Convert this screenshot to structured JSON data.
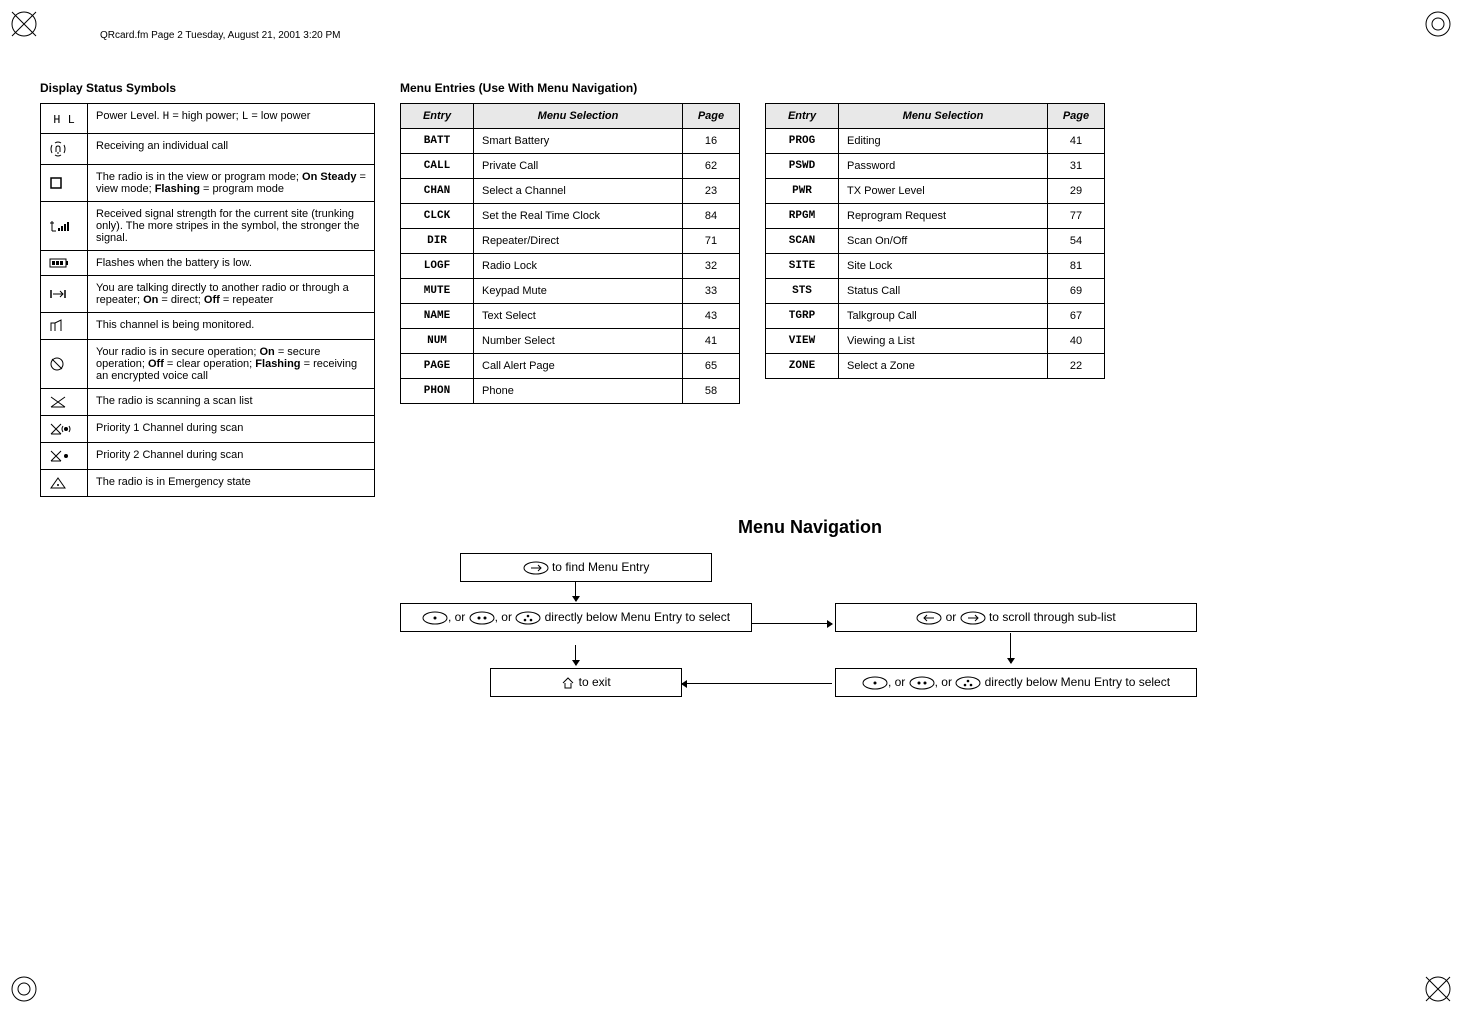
{
  "header_small": "QRcard.fm  Page 2  Tuesday, August 21, 2001  3:20 PM",
  "col1_title": "Display Status Symbols",
  "status_rows": [
    {
      "sym": "H L",
      "desc_html": "Power Level. <span style='font-family:Courier New'>H</span> = high power; <span style='font-family:Courier New'>L</span> = low power"
    },
    {
      "sym": "ring",
      "desc_html": "Receiving an individual call"
    },
    {
      "sym": "square",
      "desc_html": "The radio is in the view or program mode; <b>On Steady</b> = view mode; <b>Flashing</b> = program mode"
    },
    {
      "sym": "signal",
      "desc_html": "Received signal strength for the current site (trunking only). The more stripes in the symbol, the stronger the signal."
    },
    {
      "sym": "battery",
      "desc_html": "Flashes when the battery is low."
    },
    {
      "sym": "direct",
      "desc_html": "You are talking directly to another radio or through a repeater; <b>On</b> = direct; <b>Off</b> = repeater"
    },
    {
      "sym": "monitor",
      "desc_html": "This channel is being monitored."
    },
    {
      "sym": "secure",
      "desc_html": "Your radio is in secure operation; <b>On</b> = secure operation; <b>Off</b> = clear operation; <b>Flashing</b> = receiving an encrypted voice call"
    },
    {
      "sym": "scan",
      "desc_html": "The radio is scanning a scan list"
    },
    {
      "sym": "scan-p1",
      "desc_html": "Priority 1 Channel during scan"
    },
    {
      "sym": "scan-p2",
      "desc_html": "Priority 2 Channel during scan"
    },
    {
      "sym": "emergency",
      "desc_html": "The radio is in Emergency state"
    }
  ],
  "col2_title": "Menu Entries (Use With Menu Navigation)",
  "menu_header": {
    "entry": "Entry",
    "sel": "Menu Selection",
    "page": "Page"
  },
  "menu_rows_a": [
    {
      "entry": "BATT",
      "sel": "Smart Battery",
      "page": "16"
    },
    {
      "entry": "CALL",
      "sel": "Private Call",
      "page": "62"
    },
    {
      "entry": "CHAN",
      "sel": "Select a Channel",
      "page": "23"
    },
    {
      "entry": "CLCK",
      "sel": "Set the Real Time Clock",
      "page": "84"
    },
    {
      "entry": "DIR",
      "sel": "Repeater/Direct",
      "page": "71"
    },
    {
      "entry": "LOGF",
      "sel": "Radio Lock",
      "page": "32"
    },
    {
      "entry": "MUTE",
      "sel": "Keypad Mute",
      "page": "33"
    },
    {
      "entry": "NAME",
      "sel": "Text Select",
      "page": "43"
    },
    {
      "entry": "NUM",
      "sel": "Number Select",
      "page": "41"
    },
    {
      "entry": "PAGE",
      "sel": "Call Alert Page",
      "page": "65"
    },
    {
      "entry": "PHON",
      "sel": "Phone",
      "page": "58"
    }
  ],
  "menu_rows_b": [
    {
      "entry": "PROG",
      "sel": "Editing",
      "page": "41"
    },
    {
      "entry": "PSWD",
      "sel": "Password",
      "page": "31"
    },
    {
      "entry": "PWR",
      "sel": "TX Power Level",
      "page": "29"
    },
    {
      "entry": "RPGM",
      "sel": "Reprogram Request",
      "page": "77"
    },
    {
      "entry": "SCAN",
      "sel": "Scan On/Off",
      "page": "54"
    },
    {
      "entry": "SITE",
      "sel": "Site Lock",
      "page": "81"
    },
    {
      "entry": "STS",
      "sel": "Status Call",
      "page": "69"
    },
    {
      "entry": "TGRP",
      "sel": "Talkgroup Call",
      "page": "67"
    },
    {
      "entry": "VIEW",
      "sel": "Viewing a List",
      "page": "40"
    },
    {
      "entry": "ZONE",
      "sel": "Select a Zone",
      "page": "22"
    }
  ],
  "menu_nav_title": "Menu Navigation",
  "nav": {
    "find": " to find Menu Entry",
    "select1_a": ", or ",
    "select1_b": ", or ",
    "select1_c": " directly below Menu Entry to select",
    "scroll_a": " or ",
    "scroll_b": " to scroll through sub-list",
    "select2_a": ", or ",
    "select2_b": ", or ",
    "select2_c": " directly below Menu Entry to select",
    "exit": " to exit"
  }
}
